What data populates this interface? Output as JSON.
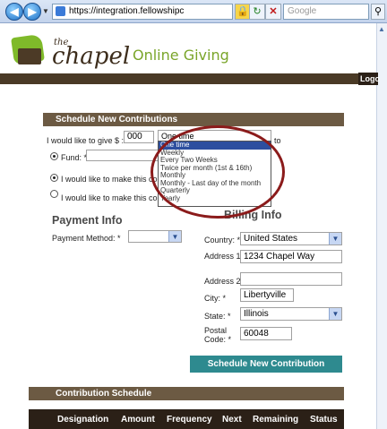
{
  "browser": {
    "url": "https://integration.fellowshipc",
    "search_placeholder": "Google",
    "back_glyph": "◀",
    "forward_glyph": "▶"
  },
  "header": {
    "logo_small": "the",
    "logo_text": "chapel",
    "title": "Online Giving",
    "logout_label": "Logo"
  },
  "schedule": {
    "section_title": "Schedule New Contributions",
    "give_label": "I would like to give $ : *",
    "amount_value": "000",
    "frequency_selected": "One time",
    "to_label": "to",
    "fund_label": "Fund: *",
    "option1_label": "I would like to make this contribu",
    "option2_label": "I would like to make this contribu",
    "frequency_options": [
      "One time",
      "Weekly",
      "Every Two Weeks",
      "Twice per month (1st & 16th)",
      "Monthly",
      "Monthly - Last day of the month",
      "Quarterly",
      "Yearly"
    ]
  },
  "payment": {
    "heading": "Payment Info",
    "method_label": "Payment Method: *",
    "method_value": ""
  },
  "billing": {
    "heading": "Billing Info",
    "country_label": "Country: *",
    "country_value": "United States",
    "address1_label": "Address 1: *",
    "address1_value": "1234 Chapel Way",
    "address2_label": "Address 2:",
    "address2_value": "",
    "city_label": "City: *",
    "city_value": "Libertyville",
    "state_label": "State: *",
    "state_value": "Illinois",
    "postal_label": "Postal Code: *",
    "postal_value": "60048"
  },
  "submit_label": "Schedule New Contribution",
  "contribution_schedule": {
    "title": "Contribution Schedule",
    "columns": [
      "Designation",
      "Amount",
      "Frequency",
      "Next",
      "Remaining",
      "Status"
    ]
  },
  "colors": {
    "section_bar": "#6c5a43",
    "brand_green": "#7aa52a",
    "button": "#2e8a8f",
    "highlight": "#2d4f9f",
    "annotation": "#8b1b1b"
  }
}
